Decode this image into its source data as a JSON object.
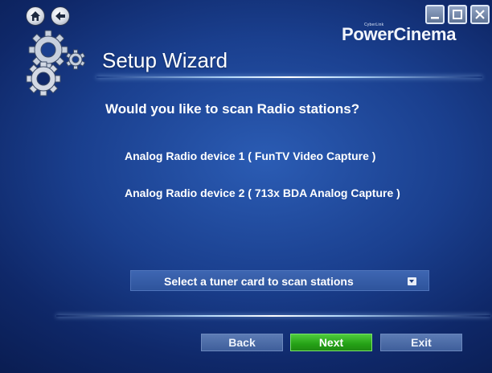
{
  "window": {
    "brand_small": "CyberLink",
    "brand": "PowerCinema",
    "title": "Setup Wizard"
  },
  "nav": {
    "home_icon": "home-icon",
    "back_icon": "back-arrow-icon"
  },
  "window_controls": {
    "minimize_icon": "minimize-icon",
    "maximize_icon": "maximize-icon",
    "close_icon": "close-icon"
  },
  "content": {
    "question": "Would you like to scan Radio stations?",
    "devices": [
      "Analog Radio device 1 ( FunTV Video Capture )",
      "Analog Radio device 2 ( 713x BDA Analog Capture )"
    ],
    "tuner_select": {
      "selected": "Select a tuner card to scan stations"
    }
  },
  "buttons": {
    "back": "Back",
    "next": "Next",
    "exit": "Exit"
  },
  "colors": {
    "background": "#1a3f8e",
    "accent_next": "#25a116",
    "button": "#4a6aa6"
  }
}
